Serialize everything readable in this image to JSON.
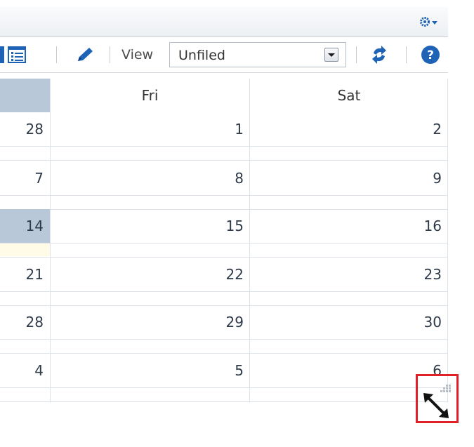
{
  "toolbar": {
    "view_label": "View",
    "view_value": "Unfiled"
  },
  "calendar": {
    "headers": [
      "Fri",
      "Sat"
    ],
    "rows": [
      {
        "left": "28",
        "fri": "1",
        "sat": "2"
      },
      {
        "left": "7",
        "fri": "8",
        "sat": "9"
      },
      {
        "left": "14",
        "fri": "15",
        "sat": "16"
      },
      {
        "left": "21",
        "fri": "22",
        "sat": "23"
      },
      {
        "left": "28",
        "fri": "29",
        "sat": "30"
      },
      {
        "left": "4",
        "fri": "5",
        "sat": "6"
      }
    ]
  },
  "colors": {
    "highlight": "#b9c8d9",
    "today_strip": "#fffbe6",
    "red_frame": "#e01f26",
    "icon_blue": "#1e63b6"
  },
  "icons": [
    "list-view-icon",
    "pencil-icon",
    "refresh-icon",
    "help-icon",
    "gear-icon",
    "resize-icon"
  ]
}
